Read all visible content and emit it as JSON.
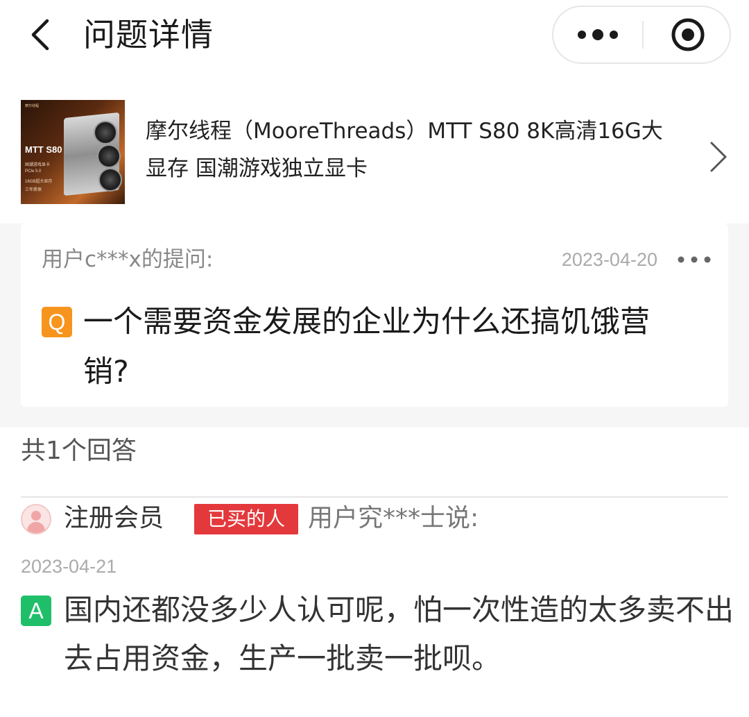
{
  "header": {
    "back_icon": "chevron-left-icon",
    "title": "问题详情",
    "capsule": {
      "more_icon": "more-dots-icon",
      "close_icon": "target-close-icon"
    }
  },
  "product": {
    "name": "摩尔线程（MooreThreads）MTT S80 8K高清16G大显存 国潮游戏独立显卡",
    "thumbnail": {
      "brand": "摩尔线程",
      "title": "MTT S80",
      "lines": [
        "国潮游戏显卡",
        "PCIe 5.0",
        "16GB超大显存",
        "三年质保"
      ]
    },
    "arrow_icon": "chevron-right-icon"
  },
  "question": {
    "asker": "用户c***x的提问:",
    "date": "2023-04-20",
    "more_icon": "more-dots-icon",
    "badge": "Q",
    "text": "一个需要资金发展的企业为什么还搞饥饿营销?"
  },
  "answers": {
    "count_label": "共1个回答",
    "items": [
      {
        "member_label": "注册会员",
        "buyer_badge": "已买的人",
        "author": "用户究***士说:",
        "date": "2023-04-21",
        "badge": "A",
        "text": "国内还都没多少人认可呢，怕一次性造的太多卖不出去占用资金，生产一批卖一批呗。"
      }
    ]
  },
  "colors": {
    "question_badge": "#f7941d",
    "answer_badge": "#1fbf6a",
    "buyer_badge": "#e4393c",
    "section_bg": "#f6f6f6"
  }
}
